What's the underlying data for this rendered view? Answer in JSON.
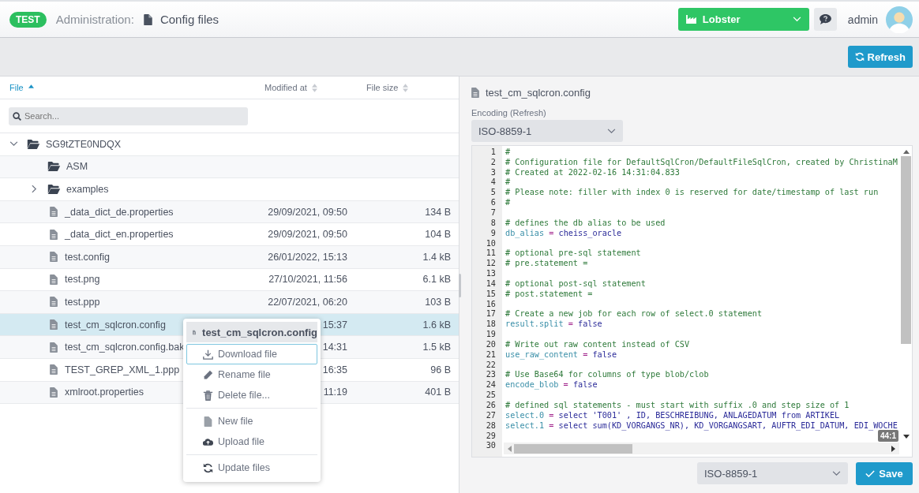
{
  "header": {
    "badge": "TEST",
    "section": "Administration:",
    "title": "Config files",
    "company": "Lobster",
    "user": "admin"
  },
  "toolbar": {
    "refresh": "Refresh"
  },
  "table": {
    "columns": [
      {
        "label": "File",
        "sorted": true
      },
      {
        "label": "Modified at",
        "sorted": false
      },
      {
        "label": "File size",
        "sorted": false
      }
    ],
    "search": {
      "placeholder": "Search..."
    },
    "tree": [
      {
        "kind": "folder",
        "name": "SG9tZTE0NDQX",
        "expanded": true,
        "selected": false,
        "children": [
          {
            "kind": "folder",
            "name": "ASM",
            "selected": false
          },
          {
            "kind": "folder",
            "name": "examples",
            "expanded": false,
            "selected": false
          },
          {
            "kind": "file",
            "name": "_data_dict_de.properties",
            "modified": "29/09/2021, 09:50",
            "size": "134 B",
            "selected": false
          },
          {
            "kind": "file",
            "name": "_data_dict_en.properties",
            "modified": "29/09/2021, 09:50",
            "size": "104 B",
            "selected": false
          },
          {
            "kind": "file",
            "name": "test.config",
            "modified": "26/01/2022, 15:13",
            "size": "1.4 kB",
            "selected": false
          },
          {
            "kind": "file",
            "name": "test.png",
            "modified": "27/10/2021, 11:56",
            "size": "6.1 kB",
            "selected": false
          },
          {
            "kind": "file",
            "name": "test.ppp",
            "modified": "22/07/2021, 06:20",
            "size": "103 B",
            "selected": false
          },
          {
            "kind": "file",
            "name": "test_cm_sqlcron.config",
            "modified": "15:37",
            "size": "1.6 kB",
            "selected": true
          },
          {
            "kind": "file",
            "name": "test_cm_sqlcron.config.bak",
            "modified": "14:31",
            "size": "1.5 kB",
            "selected": false
          },
          {
            "kind": "file",
            "name": "TEST_GREP_XML_1.ppp",
            "modified": "16:35",
            "size": "96 B",
            "selected": false
          },
          {
            "kind": "file",
            "name": "xmlroot.properties",
            "modified": "11:19",
            "size": "401 B",
            "selected": false
          }
        ]
      }
    ]
  },
  "context_menu": {
    "title": "test_cm_sqlcron.config",
    "groups": [
      [
        {
          "kind": "download",
          "label": "Download file",
          "selected": true
        },
        {
          "kind": "rename",
          "label": "Rename file",
          "selected": false
        },
        {
          "kind": "delete",
          "label": "Delete file...",
          "selected": false
        }
      ],
      [
        {
          "kind": "new",
          "label": "New file",
          "selected": false
        },
        {
          "kind": "upload",
          "label": "Upload file",
          "selected": false
        }
      ],
      [
        {
          "kind": "update",
          "label": "Update files",
          "selected": false
        }
      ]
    ]
  },
  "editor_panel": {
    "file_name": "test_cm_sqlcron.config",
    "encoding_label": "Encoding (Refresh)",
    "encoding": "ISO-8859-1",
    "lines": [
      {
        "no": "1",
        "kind": "comment",
        "text": "#"
      },
      {
        "no": "2",
        "kind": "comment",
        "text": "# Configuration file for DefaultSqlCron/DefaultFileSqlCron, created by ChristinaM"
      },
      {
        "no": "3",
        "kind": "comment",
        "text": "# Created at 2022-02-16 14:31:04.833"
      },
      {
        "no": "4",
        "kind": "comment",
        "text": "#"
      },
      {
        "no": "5",
        "kind": "comment",
        "text": "# Please note: filler with index 0 is reserved for date/timestamp of last run"
      },
      {
        "no": "6",
        "kind": "comment",
        "text": "#"
      },
      {
        "no": "7",
        "kind": "blank"
      },
      {
        "no": "8",
        "kind": "comment",
        "text": "# defines the db alias to be used"
      },
      {
        "no": "9",
        "kind": "assign",
        "key": "db_alias",
        "op": "=",
        "value": "cheiss_oracle"
      },
      {
        "no": "10",
        "kind": "blank"
      },
      {
        "no": "11",
        "kind": "comment",
        "text": "# optional pre-sql statement"
      },
      {
        "no": "12",
        "kind": "comment",
        "text": "# pre.statement ="
      },
      {
        "no": "13",
        "kind": "blank"
      },
      {
        "no": "14",
        "kind": "comment",
        "text": "# optional post-sql statement"
      },
      {
        "no": "15",
        "kind": "comment",
        "text": "# post.statement ="
      },
      {
        "no": "16",
        "kind": "blank"
      },
      {
        "no": "17",
        "kind": "comment",
        "text": "# Create a new job for each row of select.0 statement"
      },
      {
        "no": "18",
        "kind": "assign",
        "key": "result.split",
        "op": "=",
        "value": "false"
      },
      {
        "no": "19",
        "kind": "blank"
      },
      {
        "no": "20",
        "kind": "comment",
        "text": "# Write out raw content instead of CSV"
      },
      {
        "no": "21",
        "kind": "assign",
        "key": "use_raw_content",
        "op": "=",
        "value": "false"
      },
      {
        "no": "22",
        "kind": "blank"
      },
      {
        "no": "23",
        "kind": "comment",
        "text": "# Use Base64 for columns of type blob/clob"
      },
      {
        "no": "24",
        "kind": "assign",
        "key": "encode_blob",
        "op": "=",
        "value": "false"
      },
      {
        "no": "25",
        "kind": "blank"
      },
      {
        "no": "26",
        "kind": "comment",
        "text": "# defined sql statements - must start with suffix .0 and step size of 1"
      },
      {
        "no": "27",
        "kind": "assign",
        "key": "select.0",
        "op": "=",
        "value": "select 'T001' , ID, BESCHREIBUNG, ANLAGEDATUM from ARTIKEL"
      },
      {
        "no": "28",
        "kind": "assign",
        "key": "select.1",
        "op": "=",
        "value": "select sum(KD_VORGANGS_NR), KD_VORGANGSART, AUFTR_EDI_DATUM, EDI_WOCHE"
      },
      {
        "no": "29",
        "kind": "blank"
      },
      {
        "no": "30",
        "kind": "blank"
      }
    ],
    "cursor": "44:1",
    "footer_encoding": "ISO-8859-1",
    "save": "Save"
  }
}
